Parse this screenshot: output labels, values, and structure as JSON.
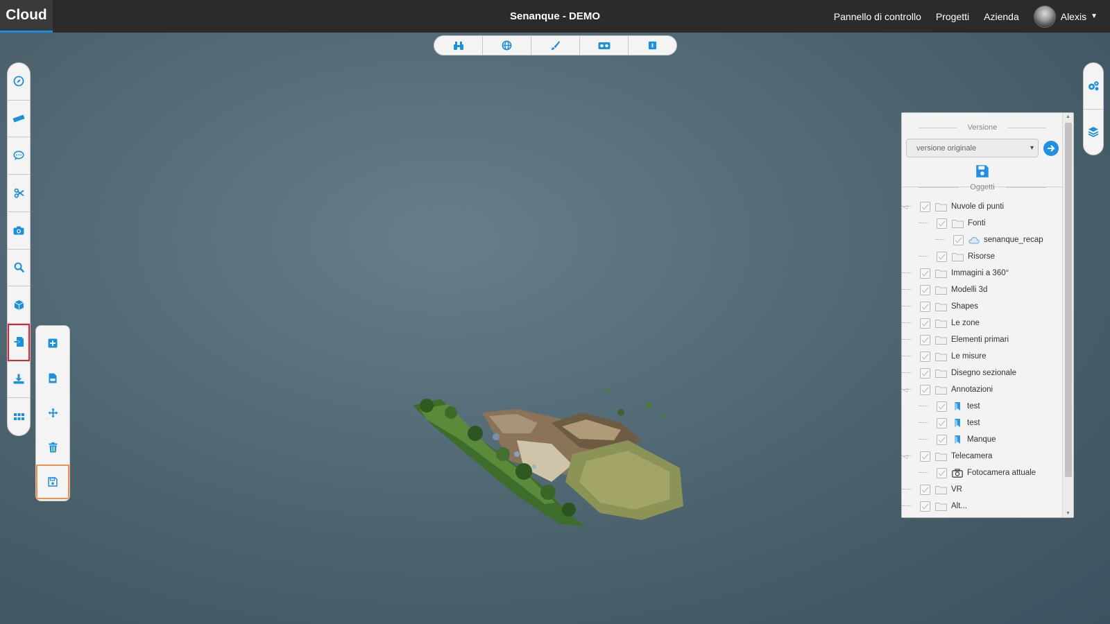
{
  "header": {
    "brand": "Cloud",
    "title": "Senanque - DEMO",
    "nav": [
      "Pannello di controllo",
      "Progetti",
      "Azienda"
    ],
    "user_name": "Alexis"
  },
  "mode_bar": {
    "buttons": [
      "binoculars-icon",
      "globe-icon",
      "brush-icon",
      "vr-headset-icon",
      "box-icon"
    ]
  },
  "left_toolbar": {
    "tools": [
      "compass-icon",
      "ruler-icon",
      "comment-icon",
      "scissors-icon",
      "camera-icon",
      "search-icon",
      "cube-icon",
      "file-import-icon",
      "download-icon",
      "grid-icon"
    ],
    "highlighted": "file-import-icon",
    "highlight_color": "#e0242f"
  },
  "sub_toolbar": {
    "tools": [
      "plus-square-icon",
      "csv-file-icon",
      "move-arrows-icon",
      "trash-icon",
      "save-icon"
    ],
    "highlighted": "save-icon",
    "highlight_color": "#f2904b"
  },
  "right_toolbar": {
    "tools": [
      "gears-icon",
      "layers-icon"
    ]
  },
  "panel": {
    "version_title": "Versione",
    "version_selected": "versione originale",
    "objects_title": "Oggetti",
    "tree": [
      {
        "label": "Nuvole di punti",
        "level": 0,
        "icon": "folder"
      },
      {
        "label": "Fonti",
        "level": 1,
        "icon": "folder"
      },
      {
        "label": "senanque_recap",
        "level": 2,
        "icon": "cloud"
      },
      {
        "label": "Risorse",
        "level": 1,
        "icon": "folder"
      },
      {
        "label": "Immagini a 360°",
        "level": 0,
        "icon": "folder"
      },
      {
        "label": "Modelli 3d",
        "level": 0,
        "icon": "folder"
      },
      {
        "label": "Shapes",
        "level": 0,
        "icon": "folder"
      },
      {
        "label": "Le zone",
        "level": 0,
        "icon": "folder"
      },
      {
        "label": "Elementi primari",
        "level": 0,
        "icon": "folder"
      },
      {
        "label": "Le misure",
        "level": 0,
        "icon": "folder"
      },
      {
        "label": "Disegno sezionale",
        "level": 0,
        "icon": "folder"
      },
      {
        "label": "Annotazioni",
        "level": 0,
        "icon": "folder"
      },
      {
        "label": "test",
        "level": 1,
        "icon": "annotation"
      },
      {
        "label": "test",
        "level": 1,
        "icon": "annotation"
      },
      {
        "label": "Manque",
        "level": 1,
        "icon": "annotation"
      },
      {
        "label": "Telecamera",
        "level": 0,
        "icon": "folder"
      },
      {
        "label": "Fotocamera attuale",
        "level": 1,
        "icon": "camera"
      },
      {
        "label": "VR",
        "level": 0,
        "icon": "folder"
      },
      {
        "label": "Alt...",
        "level": 0,
        "icon": "folder"
      }
    ]
  },
  "colors": {
    "accent": "#1f8fe8",
    "icon_blue": "#1b8fe0",
    "topbar": "#2b2b2b",
    "viewport": "#57707b"
  }
}
